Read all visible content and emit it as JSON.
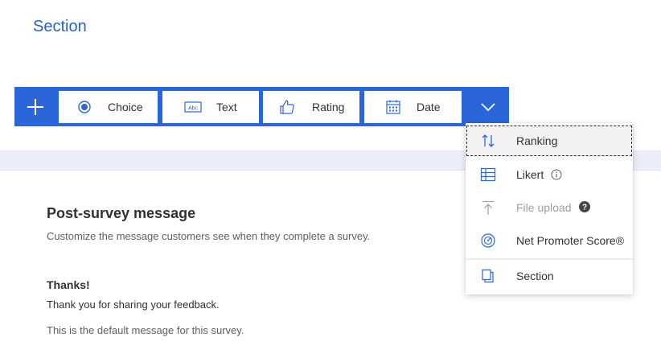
{
  "section": {
    "title": "Section"
  },
  "toolbar": {
    "add_icon": "plus-icon",
    "buttons": [
      {
        "label": "Choice",
        "icon": "radio-icon"
      },
      {
        "label": "Text",
        "icon": "text-abc-icon"
      },
      {
        "label": "Rating",
        "icon": "thumbs-up-icon"
      },
      {
        "label": "Date",
        "icon": "calendar-icon"
      }
    ],
    "more_icon": "chevron-down-icon",
    "accent_color": "#2a66d9"
  },
  "dropdown": {
    "items": [
      {
        "label": "Ranking",
        "icon": "sort-arrows-icon",
        "focused": true,
        "disabled": false
      },
      {
        "label": "Likert",
        "icon": "grid-icon",
        "badge_icon": "info-icon",
        "disabled": false
      },
      {
        "label": "File upload",
        "icon": "upload-icon",
        "badge_icon": "help-icon",
        "disabled": true
      },
      {
        "label": "Net Promoter Score®",
        "icon": "gauge-icon",
        "disabled": false
      },
      {
        "label": "Section",
        "icon": "section-icon",
        "disabled": false
      }
    ]
  },
  "post_survey": {
    "title": "Post-survey message",
    "description": "Customize the message customers see when they complete a survey.",
    "thanks_title": "Thanks!",
    "thanks_body": "Thank you for sharing your feedback.",
    "default_note": "This is the default message for this survey."
  }
}
